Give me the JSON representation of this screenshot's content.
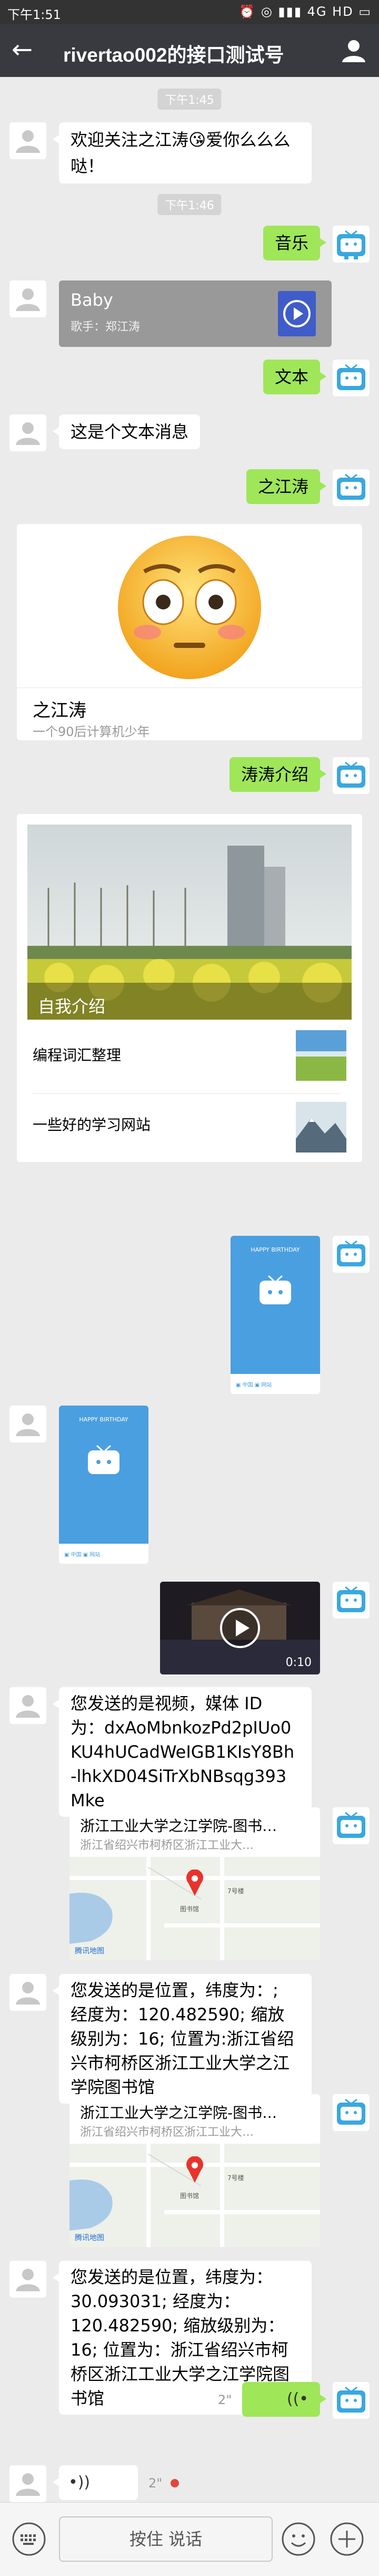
{
  "status_bar": {
    "time": "下午1:51",
    "right": "⏰ ◎ ▮▮▮ 4G HD ▭"
  },
  "title_bar": {
    "title": "rivertao002的接口测试号",
    "back_icon": "back-arrow-icon",
    "profile_icon": "person-icon"
  },
  "timestamps": [
    "下午1:45",
    "下午1:46"
  ],
  "messages": {
    "welcome": "欢迎关注之江涛😘爱你么么么哒！",
    "music_req": "音乐",
    "music_title": "Baby",
    "music_singer": "歌手：郑江涛",
    "text_req": "文本",
    "text_reply": "这是个文本消息",
    "zhijiangtao_req": "之江涛",
    "profile_card_title": "之江涛",
    "profile_card_sub": "一个90后计算机少年",
    "intro_req": "涛涛介绍",
    "news_main_title": "自我介绍",
    "news_item1": "编程词汇整理",
    "news_item2": "一些好的学习网站",
    "video_duration": "0:10",
    "video_reply": "您发送的是视频，媒体 ID 为：dxAoMbnkozPd2pIUo0KU4hUCadWeIGB1KIsY8Bh-lhkXD04SiTrXbNBsqg393Mke",
    "loc_title": "浙江工业大学之江学院-图书…",
    "loc_addr": "浙江省绍兴市柯桥区浙江工业大…",
    "map_poi": "图书馆",
    "map_pin_label": "7号楼",
    "tencent_map": "腾讯地图",
    "loc_reply1": "您发送的是位置，纬度为：; 经度为：120.482590; 缩放级别为：16; 位置为:浙江省绍兴市柯桥区浙江工业大学之江学院图书馆",
    "loc_reply2": "您发送的是位置，纬度为：30.093031; 经度为：120.482590; 缩放级别为：16; 位置为：浙江省绍兴市柯桥区浙江工业大学之江学院图书馆",
    "voice_me_dur": "2\"",
    "voice_bot_dur": "2\""
  },
  "input_bar": {
    "hold_to_talk": "按住 说话",
    "keyboard_icon": "keyboard-icon",
    "emoji_icon": "emoji-icon",
    "plus_icon": "plus-icon"
  },
  "image_card": {
    "happy_birthday": "HAPPY BIRTHDAY"
  }
}
